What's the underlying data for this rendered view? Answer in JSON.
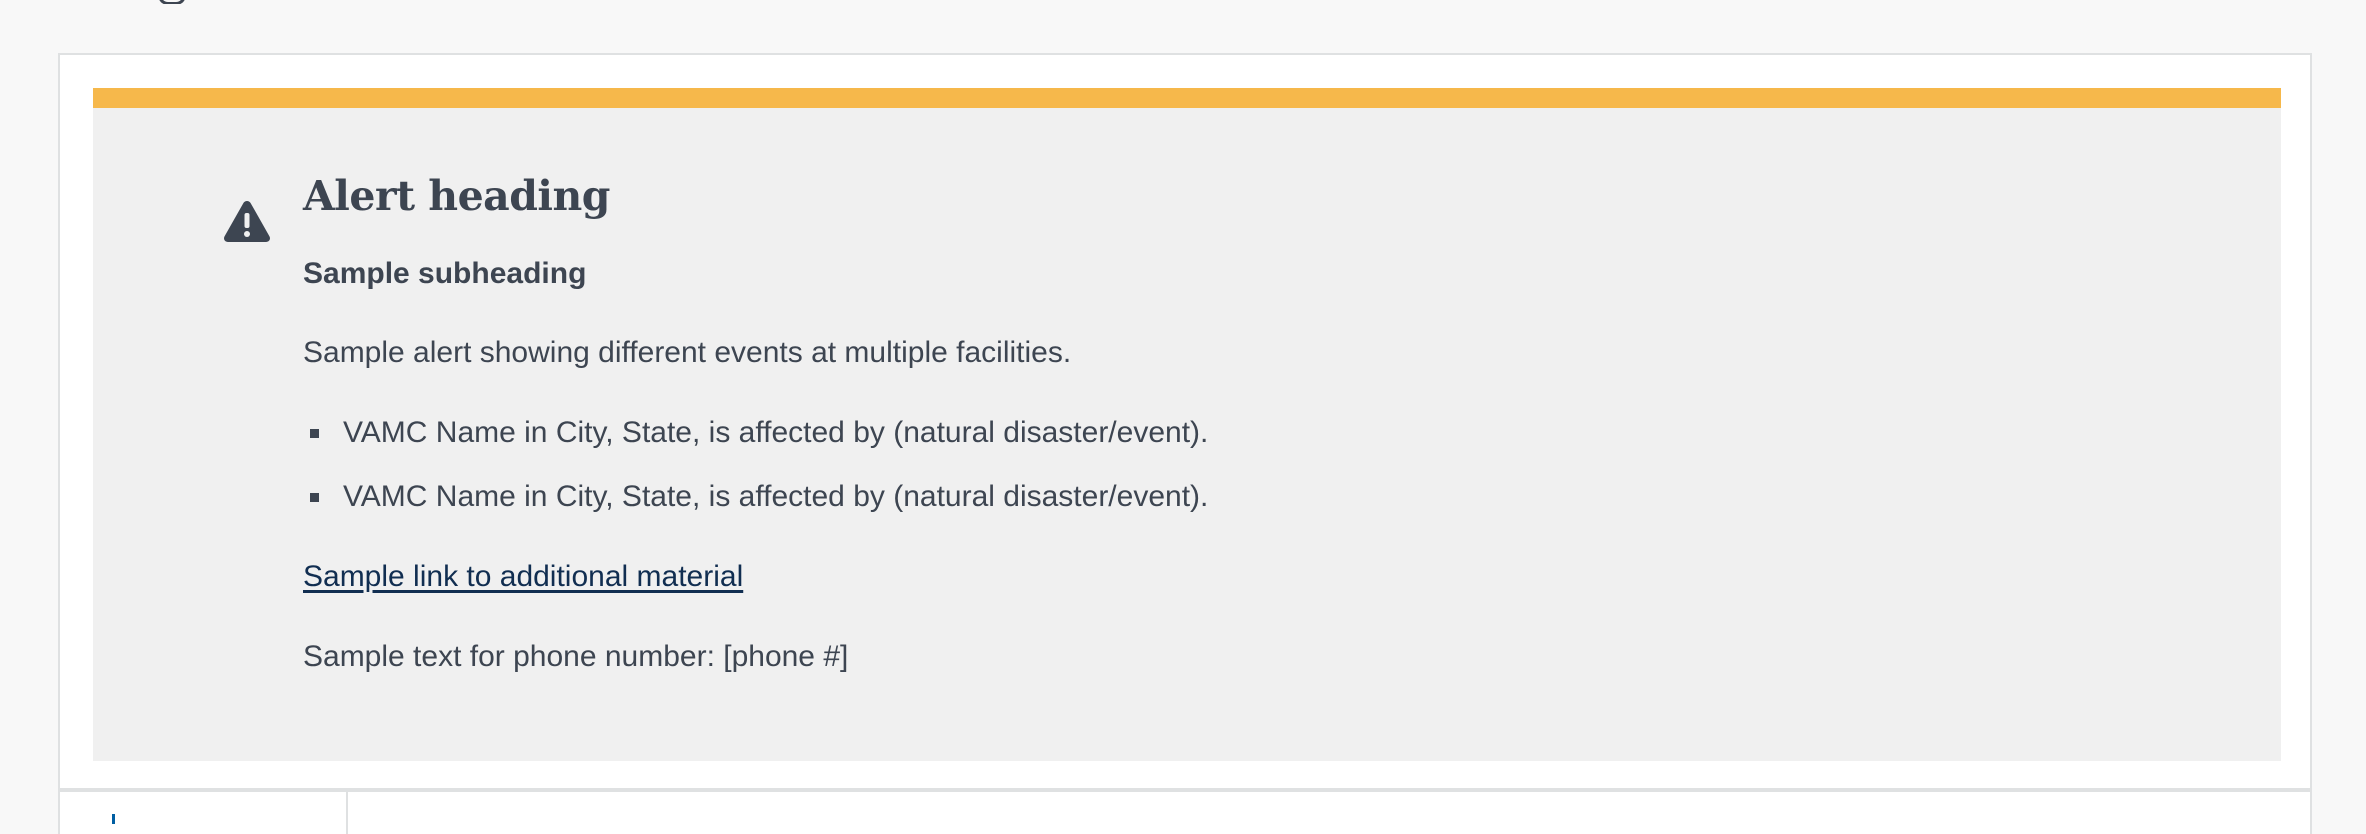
{
  "alert": {
    "status": "warning",
    "accent_color": "#f6b84b",
    "background_color": "#f0f0f0",
    "icon": "warning-triangle-icon",
    "heading": "Alert heading",
    "subheading": "Sample subheading",
    "text": "Sample alert showing different events at multiple facilities.",
    "items": [
      "VAMC Name in City, State, is affected by (natural disaster/event).",
      "VAMC Name in City, State, is affected by (natural disaster/event)."
    ],
    "link_label": "Sample link to additional material",
    "link_color": "#112e51",
    "phone_text": "Sample text for phone number: [phone #]"
  }
}
